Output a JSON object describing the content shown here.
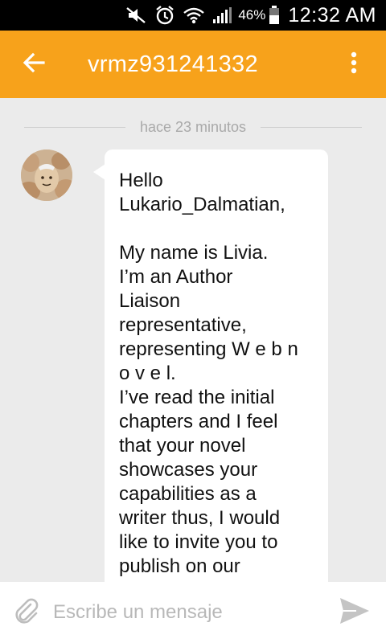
{
  "status_bar": {
    "battery_percent": "46%",
    "time": "12:32 AM",
    "icons": [
      "mute-icon",
      "alarm-icon",
      "wifi-icon",
      "signal-icon",
      "battery-icon"
    ]
  },
  "app_bar": {
    "title": "vrmz931241332",
    "background_color": "#f7a21b",
    "icons": [
      "back-arrow-icon",
      "overflow-menu-icon"
    ]
  },
  "conversation": {
    "timestamp": "hace 23 minutos",
    "message": {
      "text": "Hello\nLukario_Dalmatian,\n\nMy name is Livia.\nI’m an Author\nLiaison\nrepresentative,\nrepresenting W e b n\no v e l.\nI’ve read the initial\nchapters and I feel\nthat your novel\nshowcases your\ncapabilities as a\nwriter thus, I would\nlike to invite you to\npublish on our\nplatform Webnovel"
    }
  },
  "composer": {
    "placeholder": "Escribe un mensaje",
    "value": "",
    "icons": [
      "attach-icon",
      "send-icon"
    ]
  }
}
